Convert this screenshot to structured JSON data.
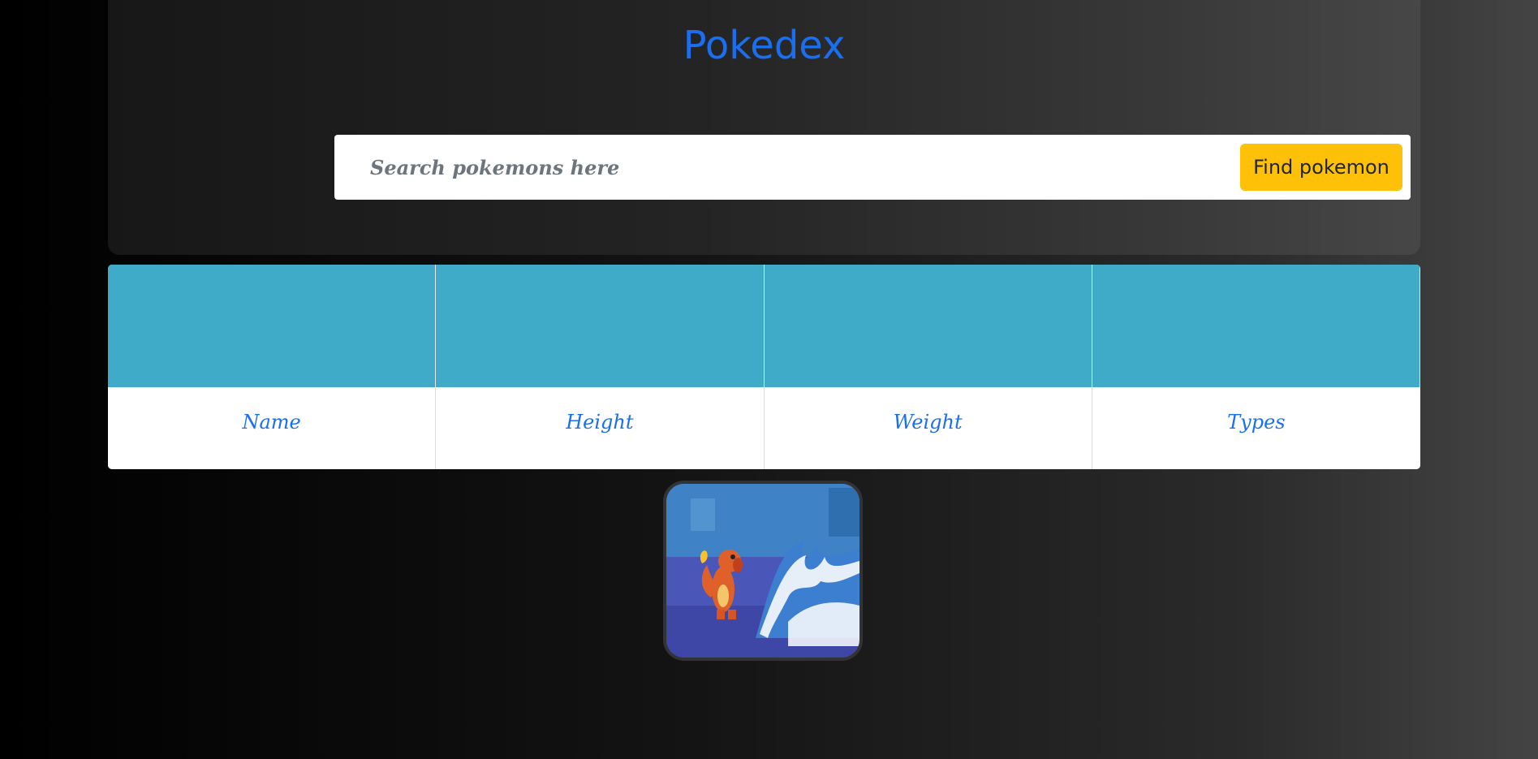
{
  "header": {
    "title": "Pokedex"
  },
  "search": {
    "placeholder": "Search pokemons here",
    "value": "",
    "button_label": "Find pokemon"
  },
  "table": {
    "columns": [
      "Name",
      "Height",
      "Weight",
      "Types"
    ]
  },
  "media": {
    "image_name": "charmander-wave-gif"
  },
  "colors": {
    "title": "#1a6ff0",
    "button": "#ffc107",
    "table_header_band": "#3fabc9"
  }
}
